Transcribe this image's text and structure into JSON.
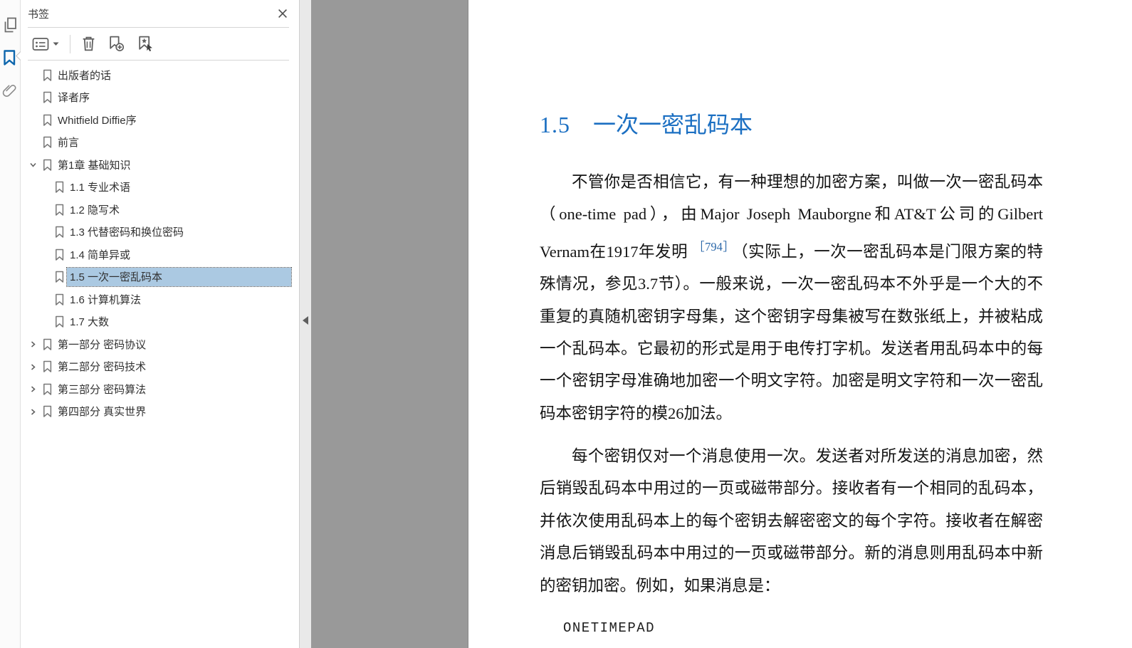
{
  "colors": {
    "heading_blue": "#1b6fc2",
    "reference_blue": "#2c68a9",
    "selection_bg": "#abc9e2",
    "doc_background": "#999999",
    "rail_active_blue": "#0d66ad"
  },
  "rail": {
    "icons": [
      "page-thumbnails",
      "bookmarks",
      "attachments"
    ],
    "active_icon": "bookmarks"
  },
  "bookmarks_panel": {
    "title": "书签",
    "toolbar_icons": [
      "options-list-icon",
      "caret-down-icon",
      "trash-icon",
      "new-bookmark-icon",
      "goto-bookmark-icon"
    ],
    "items": [
      {
        "label": "出版者的话",
        "level": 0,
        "state": "leaf",
        "selected": false
      },
      {
        "label": "译者序",
        "level": 0,
        "state": "leaf",
        "selected": false
      },
      {
        "label": "Whitfield Diffie序",
        "level": 0,
        "state": "leaf",
        "selected": false
      },
      {
        "label": "前言",
        "level": 0,
        "state": "leaf",
        "selected": false
      },
      {
        "label": "第1章 基础知识",
        "level": 0,
        "state": "expanded",
        "selected": false
      },
      {
        "label": "1.1 专业术语",
        "level": 1,
        "state": "leaf",
        "selected": false
      },
      {
        "label": "1.2 隐写术",
        "level": 1,
        "state": "leaf",
        "selected": false
      },
      {
        "label": "1.3 代替密码和换位密码",
        "level": 1,
        "state": "leaf",
        "selected": false
      },
      {
        "label": "1.4 简单异或",
        "level": 1,
        "state": "leaf",
        "selected": false
      },
      {
        "label": "1.5 一次一密乱码本",
        "level": 1,
        "state": "leaf",
        "selected": true
      },
      {
        "label": "1.6 计算机算法",
        "level": 1,
        "state": "leaf",
        "selected": false
      },
      {
        "label": "1.7 大数",
        "level": 1,
        "state": "leaf",
        "selected": false
      },
      {
        "label": "第一部分 密码协议",
        "level": 0,
        "state": "collapsed",
        "selected": false
      },
      {
        "label": "第二部分 密码技术",
        "level": 0,
        "state": "collapsed",
        "selected": false
      },
      {
        "label": "第三部分 密码算法",
        "level": 0,
        "state": "collapsed",
        "selected": false
      },
      {
        "label": "第四部分 真实世界",
        "level": 0,
        "state": "collapsed",
        "selected": false
      }
    ]
  },
  "document": {
    "section_number": "1.5",
    "section_title": "一次一密乱码本",
    "paragraph1_before_ref": "不管你是否相信它，有一种理想的加密方案，叫做一次一密乱码本（one-time pad），由Major Joseph Mauborgne和AT&T公司的Gilbert Vernam在1917年发明",
    "paragraph1_ref": "［794］",
    "paragraph1_after_ref": "（实际上，一次一密乱码本是门限方案的特殊情况，参见3.7节）。一般来说，一次一密乱码本不外乎是一个大的不重复的真随机密钥字母集，这个密钥字母集被写在数张纸上，并被粘成一个乱码本。它最初的形式是用于电传打字机。发送者用乱码本中的每一个密钥字母准确地加密一个明文字符。加密是明文字符和一次一密乱码本密钥字符的模26加法。",
    "paragraph2": "每个密钥仅对一个消息使用一次。发送者对所发送的消息加密，然后销毁乱码本中用过的一页或磁带部分。接收者有一个相同的乱码本，并依次使用乱码本上的每个密钥去解密密文的每个字符。接收者在解密消息后销毁乱码本中用过的一页或磁带部分。新的消息则用乱码本中新的密钥加密。例如，如果消息是：",
    "code_line": "ONETIMEPAD"
  }
}
